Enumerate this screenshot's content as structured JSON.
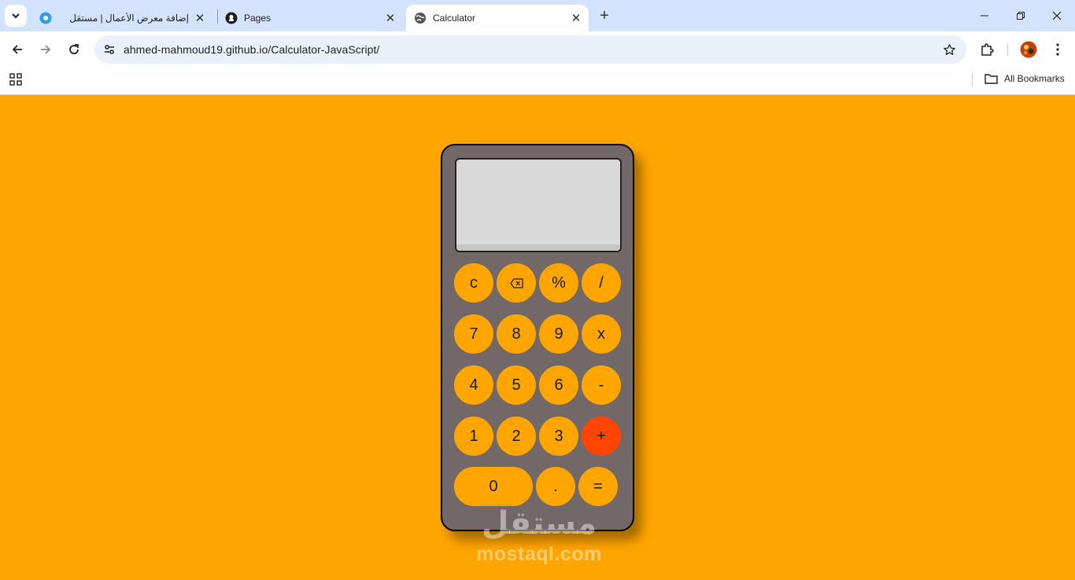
{
  "browser": {
    "tabs": [
      {
        "title": "إضافة معرض الأعمال | مستقل",
        "icon": "mostaql-favicon",
        "active": false
      },
      {
        "title": "Pages",
        "icon": "github-icon",
        "active": false
      },
      {
        "title": "Calculator",
        "icon": "globe-icon",
        "active": true
      }
    ],
    "url": "ahmed-mahmoud19.github.io/Calculator-JavaScript/",
    "bookmarks_bar": {
      "all_bookmarks_label": "All Bookmarks"
    }
  },
  "calculator": {
    "display_value": "",
    "rows": [
      [
        "c",
        "⌫",
        "%",
        "/"
      ],
      [
        "7",
        "8",
        "9",
        "x"
      ],
      [
        "4",
        "5",
        "6",
        "-"
      ],
      [
        "1",
        "2",
        "3",
        "+"
      ],
      [
        "0",
        ".",
        "="
      ]
    ],
    "colors": {
      "background": "#ffa500",
      "body": "#736868",
      "screen": "#d9d9d9",
      "key": "#ffa500",
      "plus_key": "#ff4500"
    }
  },
  "watermark": {
    "arabic": "مستقل",
    "latin": "mostaql.com"
  }
}
